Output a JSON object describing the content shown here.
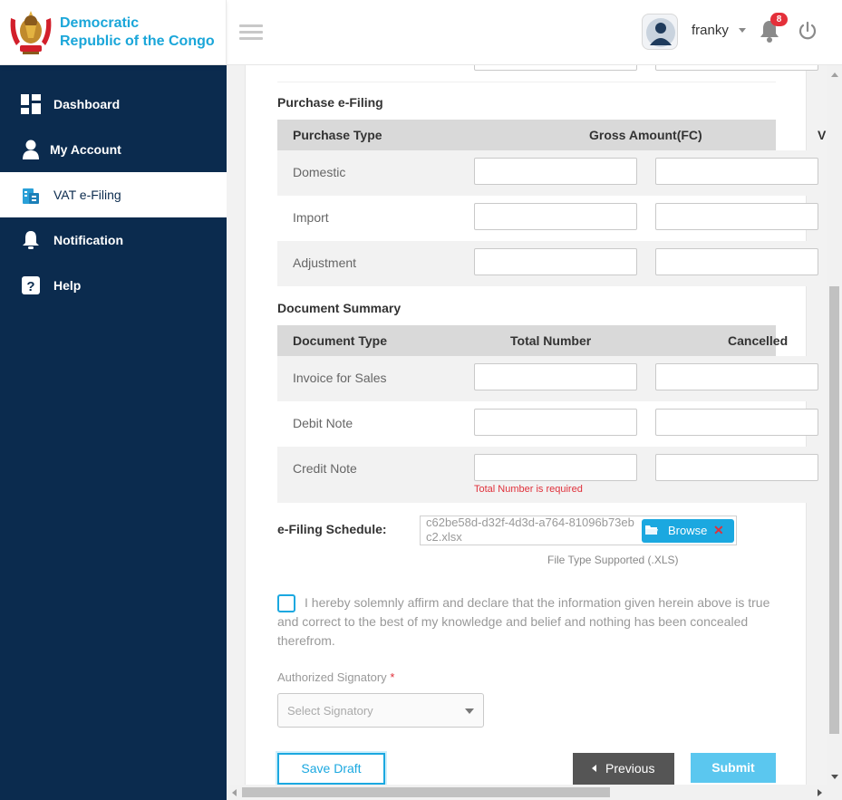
{
  "brand": {
    "line1": "Democratic",
    "line2": "Republic of the Congo"
  },
  "header": {
    "username": "franky",
    "notification_count": "8"
  },
  "sidebar": {
    "items": [
      {
        "label": "Dashboard",
        "icon": "dashboard-icon"
      },
      {
        "label": "My Account",
        "icon": "user-icon"
      },
      {
        "label": "VAT e-Filing",
        "icon": "vat-filing-icon",
        "active": true
      },
      {
        "label": "Notification",
        "icon": "bell-icon"
      },
      {
        "label": "Help",
        "icon": "help-icon"
      }
    ]
  },
  "purchase": {
    "title": "Purchase e-Filing",
    "headers": [
      "Purchase Type",
      "Gross Amount(FC)",
      "V"
    ],
    "rows": [
      "Domestic",
      "Import",
      "Adjustment"
    ]
  },
  "document": {
    "title": "Document Summary",
    "headers": [
      "Document Type",
      "Total Number",
      "Cancelled"
    ],
    "rows": [
      "Invoice for Sales",
      "Debit Note",
      "Credit Note"
    ],
    "error": "Total Number is required"
  },
  "schedule": {
    "label": "e-Filing Schedule:",
    "filename": "c62be58d-d32f-4d3d-a764-81096b73ebc2.xlsx",
    "browse_label": "Browse",
    "remove_label": "✕",
    "hint": "File Type Supported (.XLS)"
  },
  "declaration": "I hereby solemnly affirm and declare that the information given herein above is true and correct to the best of my knowledge and belief and nothing has been concealed therefrom.",
  "signatory": {
    "label": "Authorized Signatory",
    "required": "*",
    "placeholder": "Select Signatory"
  },
  "buttons": {
    "save_draft": "Save Draft",
    "previous": "Previous",
    "submit": "Submit"
  },
  "colors": {
    "sidebar": "#0b2b4e",
    "accent": "#1ba8e0",
    "error": "#e0303a"
  }
}
